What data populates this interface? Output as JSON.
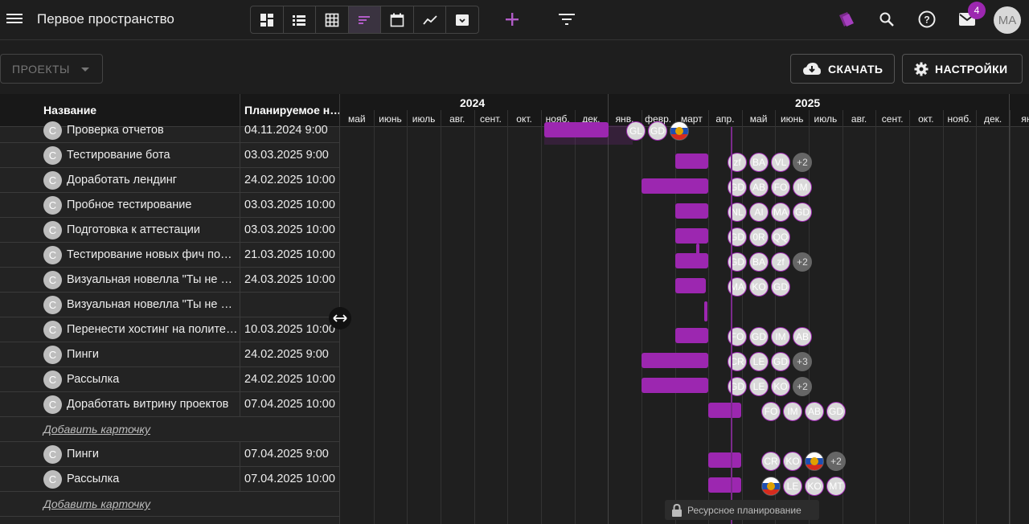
{
  "header": {
    "workspace_title": "Первое пространство",
    "mail_count": "4",
    "user_initials": "MA",
    "accent": "#9c27b0"
  },
  "toolbar": {
    "views": [
      {
        "icon": "dashboard-icon"
      },
      {
        "icon": "list-icon"
      },
      {
        "icon": "table-icon"
      },
      {
        "icon": "gantt-icon",
        "active": true
      },
      {
        "icon": "calendar-icon"
      },
      {
        "icon": "chart-icon"
      },
      {
        "icon": "archive-icon"
      }
    ],
    "projects_label": "ПРОЕКТЫ",
    "download_label": "СКАЧАТЬ",
    "settings_label": "НАСТРОЙКИ"
  },
  "table": {
    "col_name": "Название",
    "col_date": "Планируемое н…",
    "avatar_letter": "С",
    "rows": [
      {
        "name": "Проверка отчетов",
        "date": "04.11.2024 9:00"
      },
      {
        "name": "Тестирование бота",
        "date": "03.03.2025 9:00"
      },
      {
        "name": "Доработать лендинг",
        "date": "24.02.2025 10:00"
      },
      {
        "name": "Пробное тестирование",
        "date": "03.03.2025 10:00"
      },
      {
        "name": "Подготовка к аттестации",
        "date": "03.03.2025 10:00"
      },
      {
        "name": "Тестирование новых фич по…",
        "date": "21.03.2025 10:00"
      },
      {
        "name": "Визуальная новелла \"Ты не о…",
        "date": "24.03.2025 10:00"
      },
      {
        "name": "Визуальная новелла \"Ты не о…",
        "date": ""
      },
      {
        "name": "Перенести хостинг на полите…",
        "date": "10.03.2025 10:00"
      },
      {
        "name": "Пинги",
        "date": "24.02.2025 9:00"
      },
      {
        "name": "Рассылка",
        "date": "24.02.2025 10:00"
      },
      {
        "name": "Доработать витрину проектов",
        "date": "07.04.2025 10:00"
      }
    ],
    "add_card_label": "Добавить карточку",
    "rows2": [
      {
        "name": "Пинги",
        "date": "07.04.2025 9:00"
      },
      {
        "name": "Рассылка",
        "date": "07.04.2025 10:00"
      }
    ],
    "add_card_label2": "Добавить карточку"
  },
  "gantt": {
    "years": [
      "2024",
      "2025"
    ],
    "months": [
      "май",
      "июнь",
      "июль",
      "авг.",
      "сент.",
      "окт.",
      "нояб.",
      "дек.",
      "янв.",
      "февр.",
      "март",
      "апр.",
      "май",
      "июнь",
      "июль",
      "авг.",
      "сент.",
      "окт.",
      "нояб.",
      "дек.",
      "ян"
    ],
    "chips": [
      [
        "GL",
        "GD",
        "flag"
      ],
      [
        "zf",
        "BA",
        "VL",
        "+2"
      ],
      [
        "GD",
        "AB",
        "FO",
        "IM"
      ],
      [
        "NL",
        "AI",
        "MA",
        "GD"
      ],
      [
        "GD",
        "0R",
        "QQ"
      ],
      [
        "GD",
        "BA",
        "zf",
        "+2"
      ],
      [
        "MA",
        "KO",
        "GD"
      ],
      [],
      [
        "FO",
        "GD",
        "IM",
        "AB"
      ],
      [
        "CR",
        "LE",
        "GD",
        "+3"
      ],
      [
        "GD",
        "LE",
        "KO",
        "+2"
      ],
      [
        "FO",
        "IM",
        "AB",
        "GD"
      ],
      [
        "CR",
        "KO",
        "flag",
        "+2"
      ],
      [
        "flag",
        "LE",
        "KO",
        "MT"
      ]
    ],
    "resource_planning_label": "Ресурсное планирование"
  }
}
